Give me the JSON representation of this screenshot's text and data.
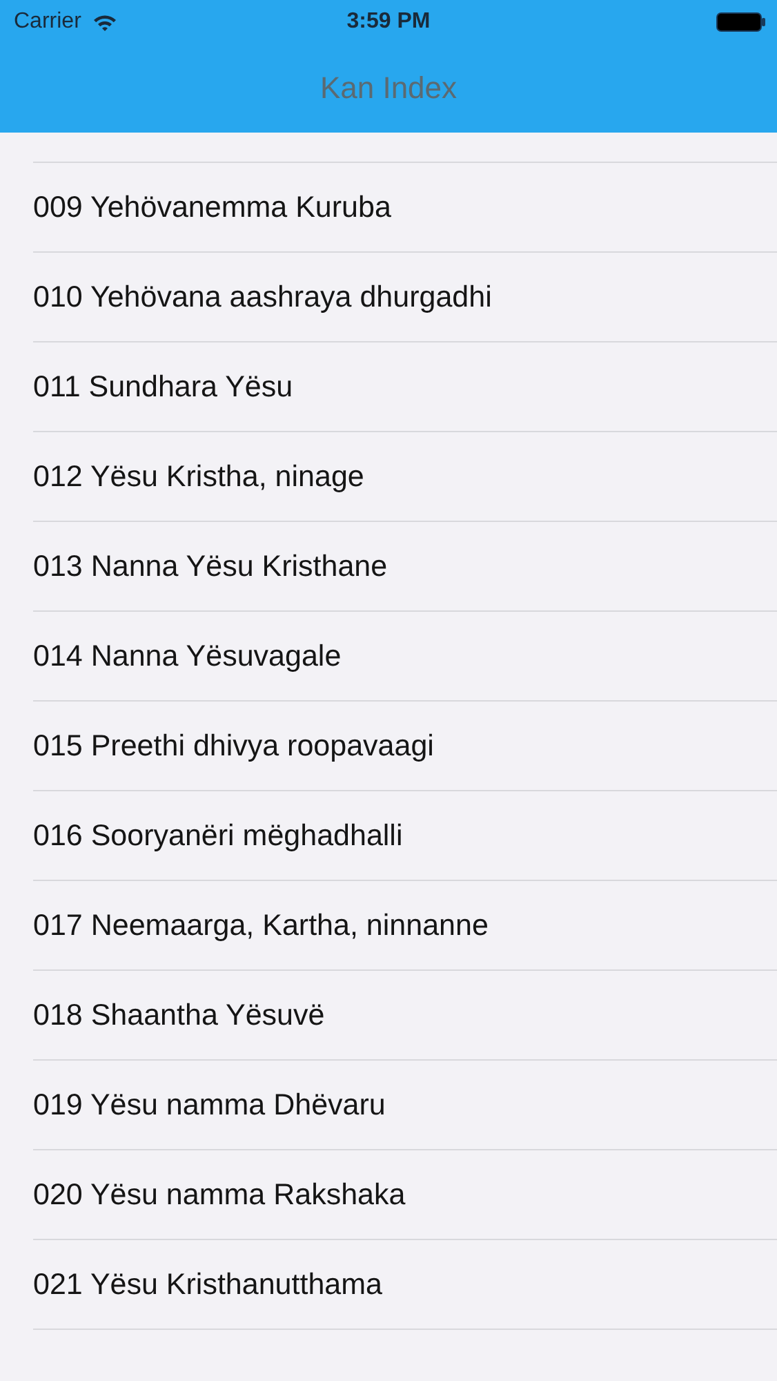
{
  "status_bar": {
    "carrier": "Carrier",
    "time": "3:59 PM"
  },
  "nav_bar": {
    "title": "Kan Index"
  },
  "items": [
    {
      "label": "009 Yehövanemma Kuruba"
    },
    {
      "label": "010 Yehövana aashraya dhurgadhi"
    },
    {
      "label": "011 Sundhara Yësu"
    },
    {
      "label": "012 Yësu Kristha, ninage"
    },
    {
      "label": "013 Nanna Yësu Kristhane"
    },
    {
      "label": "014 Nanna Yësuvagale"
    },
    {
      "label": "015 Preethi dhivya roopavaagi"
    },
    {
      "label": "016 Sooryanëri mëghadhalli"
    },
    {
      "label": "017 Neemaarga, Kartha, ninnanne"
    },
    {
      "label": "018 Shaantha Yësuvë"
    },
    {
      "label": "019 Yësu namma Dhëvaru"
    },
    {
      "label": "020 Yësu namma Rakshaka"
    },
    {
      "label": "021 Yësu Kristhanutthama"
    }
  ]
}
